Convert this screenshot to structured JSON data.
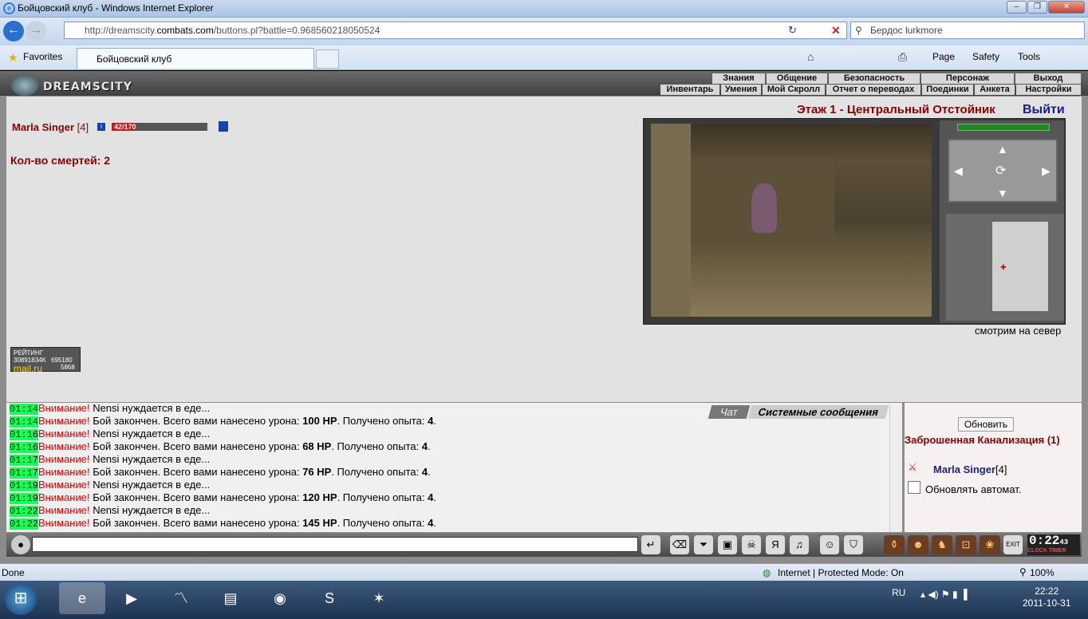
{
  "window": {
    "title": "Бойцовский клуб - Windows Internet Explorer",
    "controls": [
      "–",
      "❐",
      "✕"
    ]
  },
  "address": {
    "url_prefix": "http://dreamscity.",
    "url_domain": "combats.com",
    "url_suffix": "/buttons.pl?battle=0.968560218050524",
    "search_text": "Бердос lurkmore"
  },
  "tabs": {
    "favorites_label": "Favorites",
    "tab_title": "Бойцовский клуб",
    "page_label": "Page",
    "safety_label": "Safety",
    "tools_label": "Tools"
  },
  "game": {
    "logo": "DREAMSCITY",
    "menu_top": [
      "Знания",
      "Общение",
      "Безопасность",
      "Персонаж",
      "Выход"
    ],
    "menu_bottom": [
      "Инвентарь",
      "Умения",
      "Мой Скролл",
      "Отчет о переводах",
      "Поединки",
      "Анкета",
      "Настройки"
    ],
    "player": {
      "name": "Marla Singer",
      "level": "[4]",
      "hp_text": "42/170",
      "hp_fraction": 0.247
    },
    "deaths": "Кол-во смертей: 2",
    "location": "Этаж 1 - Центральный Отстойник",
    "exit_link": "Выйти",
    "facing": "смотрим на север",
    "rating": {
      "line1": "РЕЙТИНГ 30891834K",
      "brand": "mail.ru",
      "n1": "695180",
      "n2": "5868"
    }
  },
  "chat": {
    "tab_chat": "Чат",
    "tab_system": "Системные сообщения",
    "lines": [
      {
        "time": "01:14",
        "warn": "Внимание!",
        "pre": " Nensi нуждается в еде...",
        "bold": "",
        "mid": "",
        "exp": ""
      },
      {
        "time": "01:14",
        "warn": "Внимание!",
        "pre": " Бой закончен. Всего вами нанесено урона: ",
        "bold": "100 HP",
        "mid": ". Получено опыта: ",
        "exp": "4"
      },
      {
        "time": "01:16",
        "warn": "Внимание!",
        "pre": " Nensi нуждается в еде...",
        "bold": "",
        "mid": "",
        "exp": ""
      },
      {
        "time": "01:16",
        "warn": "Внимание!",
        "pre": " Бой закончен. Всего вами нанесено урона: ",
        "bold": "68 HP",
        "mid": ". Получено опыта: ",
        "exp": "4"
      },
      {
        "time": "01:17",
        "warn": "Внимание!",
        "pre": " Nensi нуждается в еде...",
        "bold": "",
        "mid": "",
        "exp": ""
      },
      {
        "time": "01:17",
        "warn": "Внимание!",
        "pre": " Бой закончен. Всего вами нанесено урона: ",
        "bold": "76 HP",
        "mid": ". Получено опыта: ",
        "exp": "4"
      },
      {
        "time": "01:19",
        "warn": "Внимание!",
        "pre": " Nensi нуждается в еде...",
        "bold": "",
        "mid": "",
        "exp": ""
      },
      {
        "time": "01:19",
        "warn": "Внимание!",
        "pre": " Бой закончен. Всего вами нанесено урона: ",
        "bold": "120 HP",
        "mid": ". Получено опыта: ",
        "exp": "4"
      },
      {
        "time": "01:22",
        "warn": "Внимание!",
        "pre": " Nensi нуждается в еде...",
        "bold": "",
        "mid": "",
        "exp": ""
      },
      {
        "time": "01:22",
        "warn": "Внимание!",
        "pre": " Бой закончен. Всего вами нанесено урона: ",
        "bold": "145 HP",
        "mid": ". Получено опыта: ",
        "exp": "4"
      }
    ]
  },
  "room": {
    "refresh_label": "Обновить",
    "name": "Заброшенная Канализация (1)",
    "user": "Marla Singer",
    "user_level": "[4]",
    "auto_label": "Обновлять автомат."
  },
  "clock": {
    "time": "0:22",
    "sec": "43",
    "labels": "CLOCK TIMER"
  },
  "status": {
    "left": "Done",
    "zone": "Internet | Protected Mode: On",
    "zoom": "100%"
  },
  "taskbar": {
    "lang": "RU",
    "time": "22:22",
    "date": "2011-10-31"
  }
}
